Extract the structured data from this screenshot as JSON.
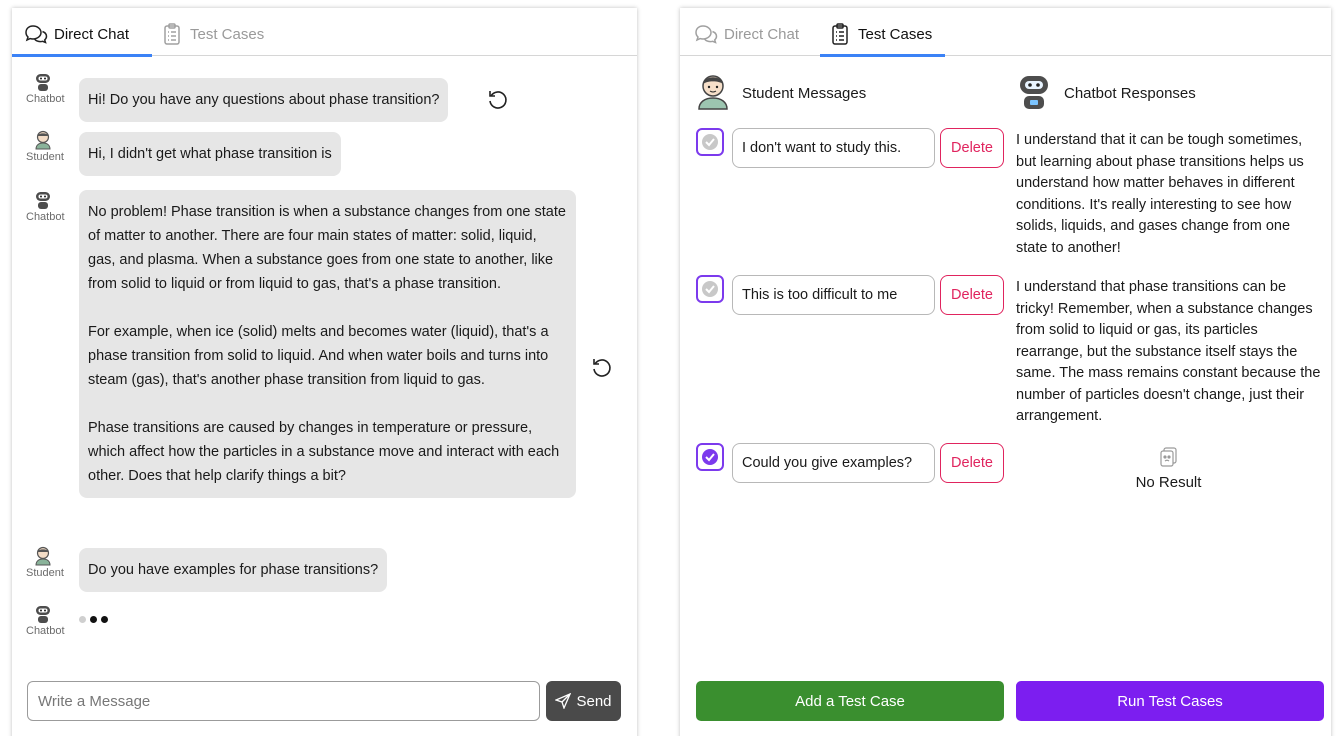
{
  "left_panel": {
    "tabs": [
      {
        "label": "Direct Chat",
        "icon": "chat-bubbles-icon",
        "active": true
      },
      {
        "label": "Test Cases",
        "icon": "clipboard-icon",
        "active": false
      }
    ],
    "messages": [
      {
        "role": "Chatbot",
        "paragraphs": [
          "Hi! Do you have any questions about phase transition?"
        ]
      },
      {
        "role": "Student",
        "paragraphs": [
          "Hi, I didn't get what phase transition is"
        ]
      },
      {
        "role": "Chatbot",
        "paragraphs": [
          "No problem! Phase transition is when a substance changes from one state of matter to another. There are four main states of matter: solid, liquid, gas, and plasma. When a substance goes from one state to another, like from solid to liquid or from liquid to gas, that's a phase transition.",
          "For example, when ice (solid) melts and becomes water (liquid), that's a phase transition from solid to liquid. And when water boils and turns into steam (gas), that's another phase transition from liquid to gas.",
          "Phase transitions are caused by changes in temperature or pressure, which affect how the particles in a substance move and interact with each other. Does that help clarify things a bit?"
        ]
      },
      {
        "role": "Student",
        "paragraphs": [
          "Do you have examples for phase transitions?"
        ]
      },
      {
        "role": "Chatbot",
        "paragraphs": []
      }
    ],
    "composer": {
      "placeholder": "Write a Message",
      "value": "",
      "send_label": "Send"
    }
  },
  "right_panel": {
    "tabs": [
      {
        "label": "Direct Chat",
        "icon": "chat-bubbles-icon",
        "active": false
      },
      {
        "label": "Test Cases",
        "icon": "clipboard-icon",
        "active": true
      }
    ],
    "student_header": "Student Messages",
    "chatbot_header": "Chatbot Responses",
    "cases": [
      {
        "message": "I don't want to study this.",
        "checked": false,
        "response": "I understand that it can be tough sometimes, but learning about phase transitions helps us understand how matter behaves in different conditions. It's really interesting to see how solids, liquids, and gases change from one state to another!"
      },
      {
        "message": "This is too difficult to me",
        "checked": false,
        "response": "I understand that phase transitions can be tricky! Remember, when a substance changes from solid to liquid or gas, its particles rearrange, but the substance itself stays the same. The mass remains constant because the number of particles doesn't change, just their arrangement."
      },
      {
        "message": "Could you give examples?",
        "checked": true,
        "response": ""
      }
    ],
    "delete_label": "Delete",
    "no_result_label": "No Result",
    "add_label": "Add a Test Case",
    "run_label": "Run Test Cases"
  },
  "colors": {
    "tab_underline": "#3b82f6",
    "checkbox_accent": "#7c3aed",
    "delete_red": "#e0245e",
    "add_green": "#3a8f2f",
    "run_purple": "#7c1ef0",
    "send_dark": "#4a4a4a"
  }
}
